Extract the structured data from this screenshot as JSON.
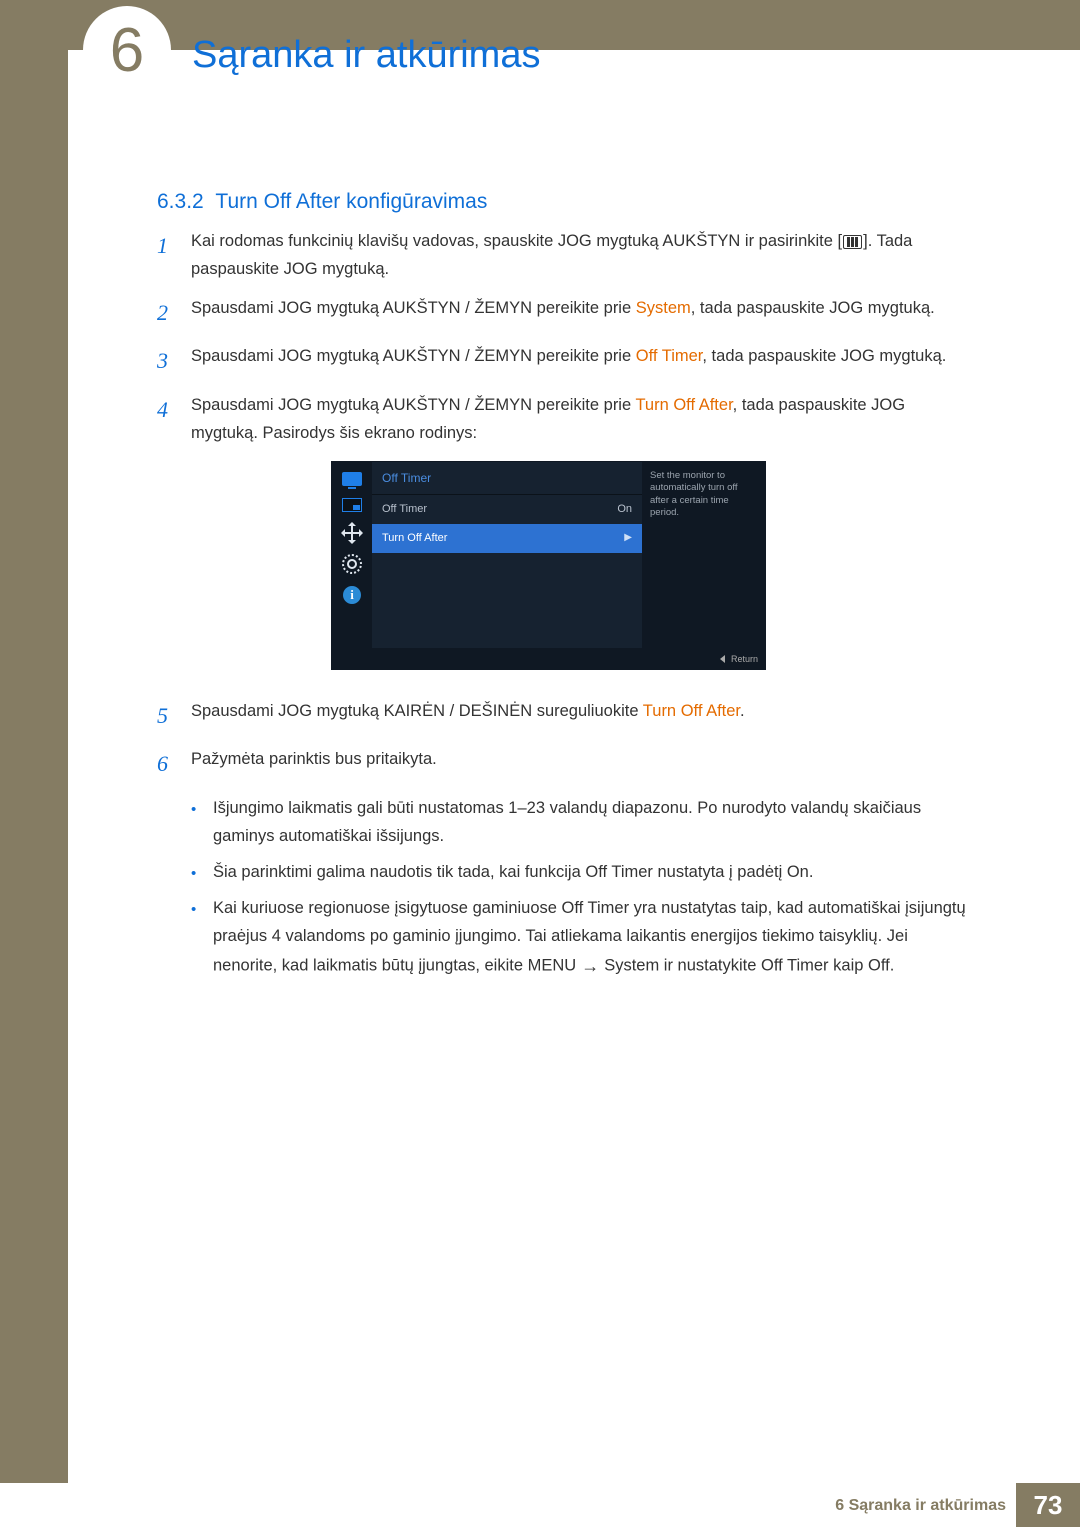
{
  "header": {
    "chapter_number": "6",
    "title": "Sąranka ir atkūrimas"
  },
  "section": {
    "number": "6.3.2",
    "title": "Turn Off After konfigūravimas"
  },
  "steps": {
    "s1": {
      "num": "1",
      "pre": "Kai rodomas funkcinių klavišų vadovas, spauskite JOG mygtuką AUKŠTYN ir pasirinkite [",
      "post": "]. Tada paspauskite JOG mygtuką."
    },
    "s2": {
      "num": "2",
      "pre": "Spausdami JOG mygtuką AUKŠTYN / ŽEMYN pereikite prie ",
      "hl": "System",
      "post": ", tada paspauskite JOG mygtuką."
    },
    "s3": {
      "num": "3",
      "pre": "Spausdami JOG mygtuką AUKŠTYN / ŽEMYN pereikite prie ",
      "hl": "Off Timer",
      "post": ", tada paspauskite JOG mygtuką."
    },
    "s4": {
      "num": "4",
      "pre": "Spausdami JOG mygtuką AUKŠTYN / ŽEMYN pereikite prie ",
      "hl": "Turn Off After",
      "post": ", tada paspauskite JOG mygtuką. Pasirodys šis ekrano rodinys:"
    },
    "s5": {
      "num": "5",
      "pre": "Spausdami JOG mygtuką KAIRĖN / DEŠINĖN sureguliuokite ",
      "hl": "Turn Off After",
      "post": "."
    },
    "s6": {
      "num": "6",
      "text": "Pažymėta parinktis bus pritaikyta."
    }
  },
  "osd": {
    "header": "Off Timer",
    "row1_label": "Off Timer",
    "row1_value": "On",
    "row2_label": "Turn Off After",
    "help": "Set the monitor to automatically turn off after a certain time period.",
    "return": "Return"
  },
  "bullets": {
    "b1": "Išjungimo laikmatis gali būti nustatomas 1–23 valandų diapazonu. Po nurodyto valandų skaičiaus gaminys automatiškai išsijungs.",
    "b2": {
      "pre": "Šia parinktimi galima naudotis tik tada, kai funkcija ",
      "hl1": "Off Timer",
      "mid": " nustatyta į padėtį ",
      "hl2": "On",
      "post": "."
    },
    "b3": {
      "pre": "Kai kuriuose regionuose įsigytuose gaminiuose ",
      "hl1": "Off Timer",
      "mid1": " yra nustatytas taip, kad automatiškai įsijungtų praėjus 4 valandoms po gaminio įjungimo. Tai atliekama laikantis energijos tiekimo taisyklių. Jei nenorite, kad laikmatis būtų įjungtas, eikite ",
      "hl2": "MENU",
      "arrow": " → ",
      "hl3": "System",
      "mid2": " ir nustatykite ",
      "hl4": "Off Timer",
      "mid3": " kaip ",
      "hl5": "Off",
      "post": "."
    }
  },
  "footer": {
    "label": "6 Sąranka ir atkūrimas",
    "page": "73"
  }
}
